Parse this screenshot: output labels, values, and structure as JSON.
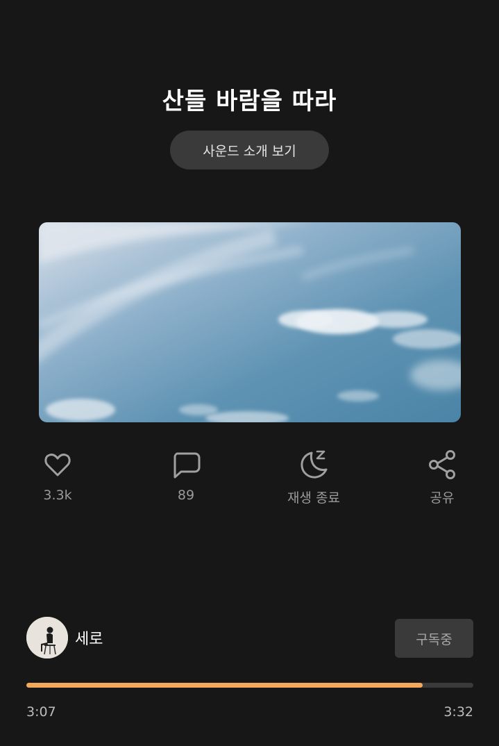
{
  "title": "산들 바람을 따라",
  "intro_button": "사운드 소개 보기",
  "actions": {
    "like": {
      "icon": "heart-icon",
      "label": "3.3k"
    },
    "comment": {
      "icon": "comment-icon",
      "label": "89"
    },
    "sleep": {
      "icon": "moon-sleep-icon",
      "label": "재생 종료"
    },
    "share": {
      "icon": "share-icon",
      "label": "공유"
    }
  },
  "creator": {
    "name": "세로",
    "subscribe_label": "구독중"
  },
  "player": {
    "elapsed": "3:07",
    "total": "3:32",
    "progress": 0.887
  },
  "colors": {
    "background": "#171717",
    "accent": "#f2a95c",
    "button": "#3a3a3a",
    "muted_text": "#9a9a9a"
  }
}
